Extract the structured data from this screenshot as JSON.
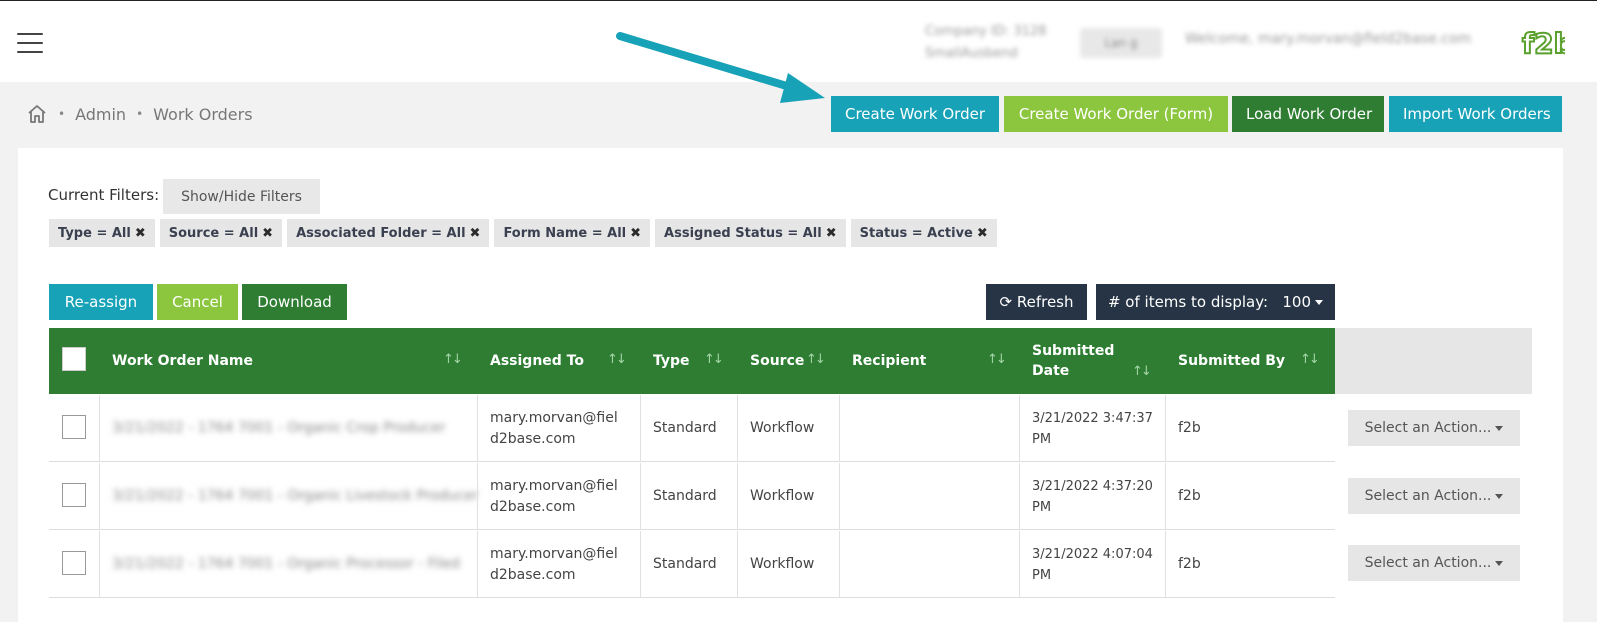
{
  "header": {
    "company_line1": "Company ID: 3128",
    "company_line2": "SmallAusbend",
    "language": "Lan g",
    "welcome": "Welcome, mary.morvan@field2base.com"
  },
  "breadcrumb": {
    "items": [
      "Admin",
      "Work Orders"
    ]
  },
  "top_actions": {
    "create": "Create Work Order",
    "create_form": "Create Work Order (Form)",
    "load": "Load Work Order",
    "import": "Import Work Orders"
  },
  "filters": {
    "label": "Current Filters:",
    "toggle": "Show/Hide Filters",
    "chips": [
      "Type = All",
      "Source = All",
      "Associated Folder = All",
      "Form Name = All",
      "Assigned Status = All",
      "Status = Active"
    ]
  },
  "bulk_actions": {
    "reassign": "Re-assign",
    "cancel": "Cancel",
    "download": "Download",
    "refresh": "Refresh",
    "items_label": "# of items to display:",
    "items_value": "100"
  },
  "table": {
    "columns": [
      "Work Order Name",
      "Assigned To",
      "Type",
      "Source",
      "Recipient",
      "Submitted",
      "Date",
      "Submitted By"
    ],
    "rows": [
      {
        "name": "3/21/2022 - 1764 7001 - Organic Crop Producer",
        "assigned_line1": "mary.morvan@fiel",
        "assigned_line2": "d2base.com",
        "type": "Standard",
        "source": "Workflow",
        "recipient": "",
        "date_line1": "3/21/2022 3:47:37",
        "date_line2": "PM",
        "submitted_by": "f2b",
        "action": "Select an Action..."
      },
      {
        "name": "3/21/2022 - 1764 7001 - Organic Livestock Producer",
        "assigned_line1": "mary.morvan@fiel",
        "assigned_line2": "d2base.com",
        "type": "Standard",
        "source": "Workflow",
        "recipient": "",
        "date_line1": "3/21/2022 4:37:20",
        "date_line2": "PM",
        "submitted_by": "f2b",
        "action": "Select an Action..."
      },
      {
        "name": "3/21/2022 - 1764 7001 - Organic Processor - Filed",
        "assigned_line1": "mary.morvan@fiel",
        "assigned_line2": "d2base.com",
        "type": "Standard",
        "source": "Workflow",
        "recipient": "",
        "date_line1": "3/21/2022 4:07:04",
        "date_line2": "PM",
        "submitted_by": "f2b",
        "action": "Select an Action..."
      }
    ]
  },
  "colors": {
    "teal": "#17a2b8",
    "lime": "#8cc63f",
    "green": "#2e7d32",
    "navy": "#263445"
  }
}
